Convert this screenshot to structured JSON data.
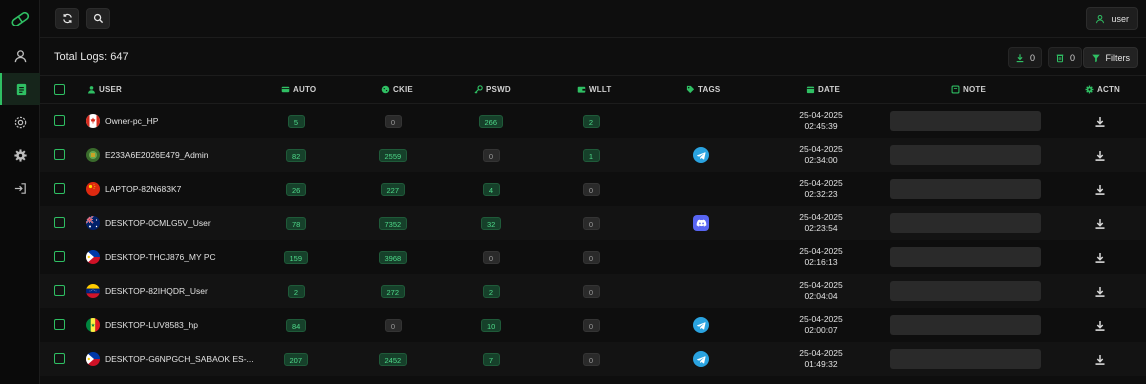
{
  "header": {
    "total_logs": "Total Logs: 647",
    "download_count": "0",
    "trash_count": "0",
    "filters_label": "Filters",
    "user_label": "user"
  },
  "columns": [
    "USER",
    "AUTO",
    "CKIE",
    "PSWD",
    "WLLT",
    "TAGS",
    "DATE",
    "NOTE",
    "ACTN"
  ],
  "colors": {
    "accent": "#2fbf63",
    "badge_green_bg": "#16402a",
    "badge_green_text": "#4fd98a",
    "badge_zero_bg": "#2a2a2a"
  },
  "rows": [
    {
      "flag": "Canada",
      "user": "Owner-pc_HP",
      "auto": "5",
      "ckie": "0",
      "pswd": "266",
      "wllt": "2",
      "tag": "",
      "date": "25-04-2025",
      "time": "02:45:39"
    },
    {
      "flag": "Generic",
      "user": "E233A6E2026E479_Admin",
      "auto": "82",
      "ckie": "2559",
      "pswd": "0",
      "wllt": "1",
      "tag": "telegram",
      "date": "25-04-2025",
      "time": "02:34:00"
    },
    {
      "flag": "China",
      "user": "LAPTOP-82N683K7",
      "auto": "26",
      "ckie": "227",
      "pswd": "4",
      "wllt": "0",
      "tag": "",
      "date": "25-04-2025",
      "time": "02:32:23"
    },
    {
      "flag": "Australia",
      "user": "DESKTOP-0CMLG5V_User",
      "auto": "78",
      "ckie": "7352",
      "pswd": "32",
      "wllt": "0",
      "tag": "discord",
      "date": "25-04-2025",
      "time": "02:23:54"
    },
    {
      "flag": "Philippines",
      "user": "DESKTOP-THCJ876_MY PC",
      "auto": "159",
      "ckie": "3968",
      "pswd": "0",
      "wllt": "0",
      "tag": "",
      "date": "25-04-2025",
      "time": "02:16:13"
    },
    {
      "flag": "Venezuela",
      "user": "DESKTOP-82IHQDR_User",
      "auto": "2",
      "ckie": "272",
      "pswd": "2",
      "wllt": "0",
      "tag": "",
      "date": "25-04-2025",
      "time": "02:04:04"
    },
    {
      "flag": "Senegal",
      "user": "DESKTOP-LUV8583_hp",
      "auto": "84",
      "ckie": "0",
      "pswd": "10",
      "wllt": "0",
      "tag": "telegram",
      "date": "25-04-2025",
      "time": "02:00:07"
    },
    {
      "flag": "Philippines",
      "user": "DESKTOP-G6NPGCH_SABAOK ES-...",
      "auto": "207",
      "ckie": "2452",
      "pswd": "7",
      "wllt": "0",
      "tag": "telegram",
      "date": "25-04-2025",
      "time": "01:49:32"
    }
  ]
}
